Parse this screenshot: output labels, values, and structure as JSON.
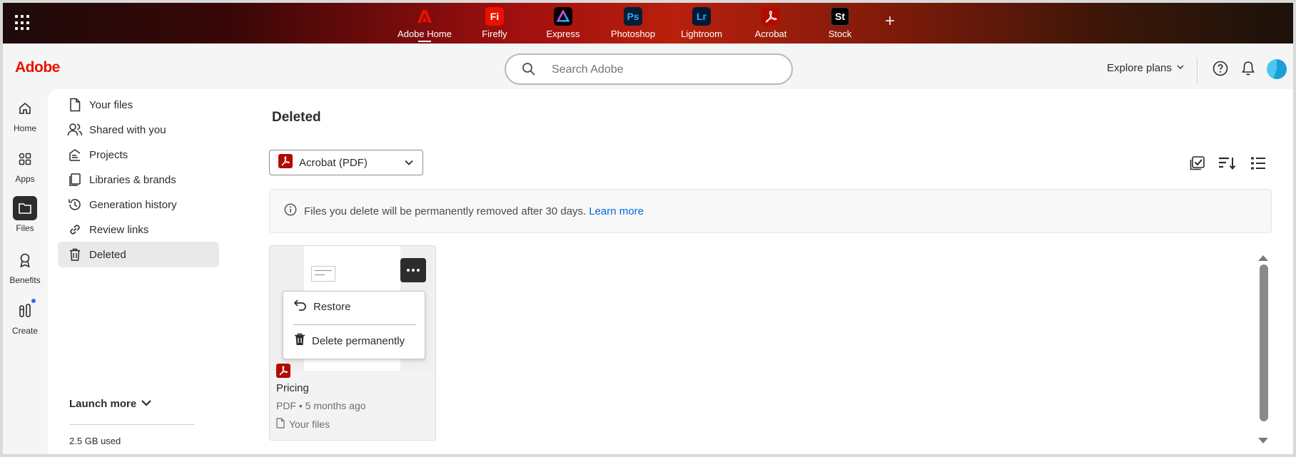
{
  "apps": [
    {
      "name": "adobe-home",
      "label": "Adobe Home",
      "badge": "",
      "color": "#eb1000",
      "active": true
    },
    {
      "name": "firefly",
      "label": "Firefly",
      "badge": "Fi",
      "color": "#eb1000"
    },
    {
      "name": "express",
      "label": "Express",
      "badge": "",
      "color": "#000000"
    },
    {
      "name": "photoshop",
      "label": "Photoshop",
      "badge": "Ps",
      "color": "#001e36"
    },
    {
      "name": "lightroom",
      "label": "Lightroom",
      "badge": "Lr",
      "color": "#001a36"
    },
    {
      "name": "acrobat",
      "label": "Acrobat",
      "badge": "",
      "color": "#b30b00"
    },
    {
      "name": "stock",
      "label": "Stock",
      "badge": "St",
      "color": "#000000"
    }
  ],
  "header": {
    "logo": "Adobe",
    "search_placeholder": "Search Adobe",
    "explore_label": "Explore plans"
  },
  "rail": [
    {
      "label": "Home"
    },
    {
      "label": "Apps"
    },
    {
      "label": "Files"
    },
    {
      "label": "Benefits"
    },
    {
      "label": "Create"
    }
  ],
  "nav": [
    {
      "label": "Your files"
    },
    {
      "label": "Shared with you"
    },
    {
      "label": "Projects"
    },
    {
      "label": "Libraries & brands"
    },
    {
      "label": "Generation history"
    },
    {
      "label": "Review links"
    },
    {
      "label": "Deleted"
    }
  ],
  "launch_more": "Launch more",
  "storage": "2.5 GB used",
  "page": {
    "title": "Deleted",
    "filter_value": "Acrobat (PDF)",
    "info_text": "Files you delete will be permanently removed after 30 days.",
    "info_link": "Learn more"
  },
  "card": {
    "name": "Pricing",
    "meta": "PDF • 5 months ago",
    "location": "Your files"
  },
  "menu": {
    "restore": "Restore",
    "delete": "Delete permanently"
  },
  "colors": {
    "accent": "#eb1000",
    "link": "#0265dc"
  }
}
